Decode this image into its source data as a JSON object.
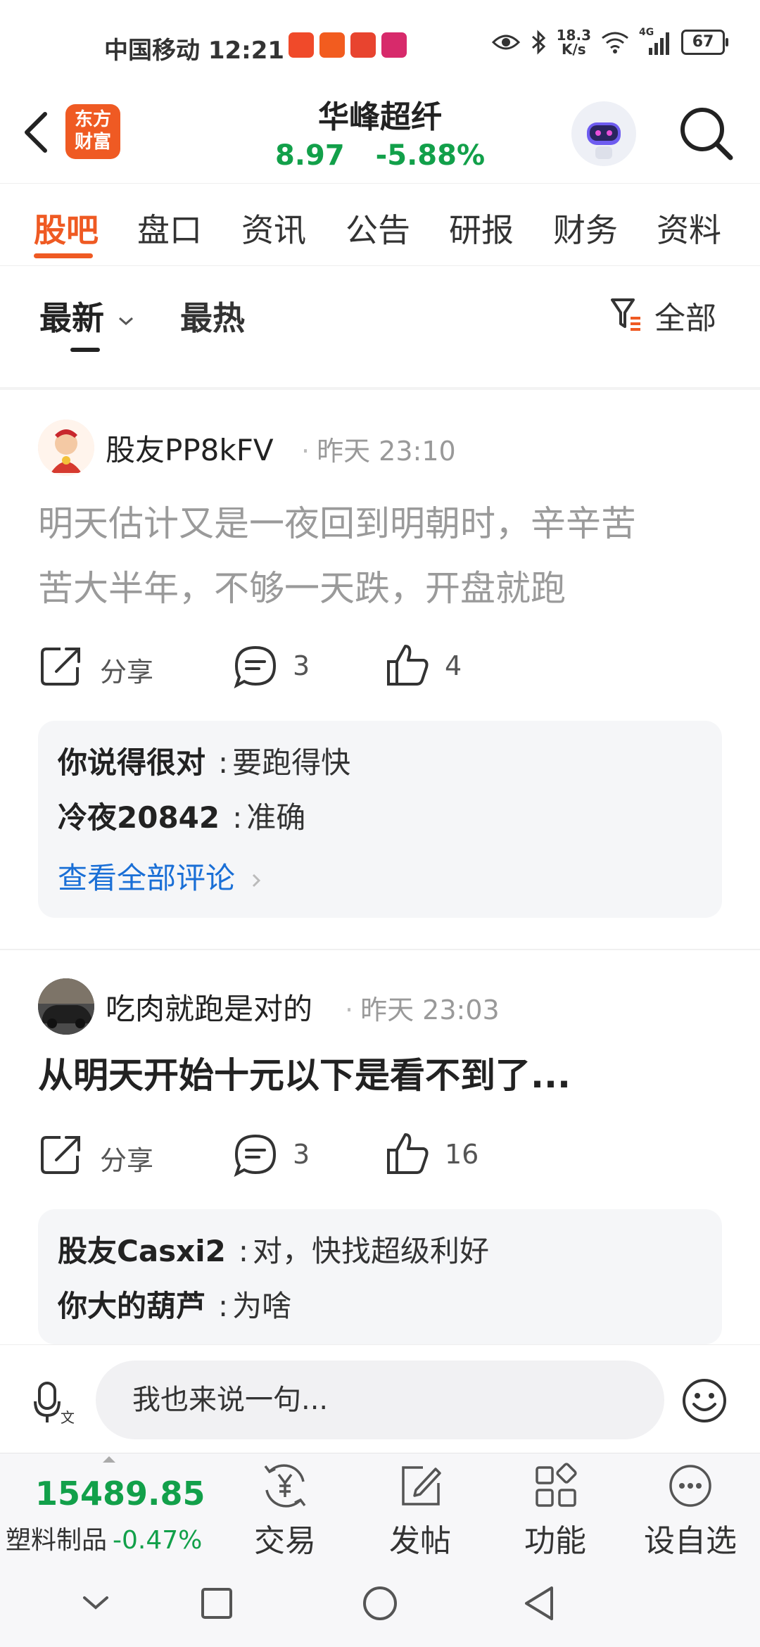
{
  "status_bar": {
    "carrier": "中国移动",
    "time": "12:21",
    "speed_value": "18.3",
    "speed_unit": "K/s",
    "network": "4G",
    "battery": "67"
  },
  "header": {
    "logo_line1": "东方",
    "logo_line2": "财富",
    "stock_name": "华峰超纤",
    "price": "8.97",
    "change_pct": "-5.88%"
  },
  "tabs": [
    {
      "label": "股吧",
      "active": true
    },
    {
      "label": "盘口"
    },
    {
      "label": "资讯"
    },
    {
      "label": "公告"
    },
    {
      "label": "研报"
    },
    {
      "label": "财务"
    },
    {
      "label": "资料"
    }
  ],
  "sort": {
    "latest": "最新",
    "hot": "最热",
    "filter": "全部"
  },
  "posts": [
    {
      "author": "股友PP8kFV",
      "time": "昨天 23:10",
      "text_line1": "明天估计又是一夜回到明朝时，辛辛苦",
      "text_line2": "苦大半年，不够一天跌，开盘就跑",
      "share": "分享",
      "comments": "3",
      "likes": "4",
      "replies": [
        {
          "name": "你说得很对",
          "sep": ":",
          "text": "要跑得快"
        },
        {
          "name": "冷夜20842",
          "sep": ":",
          "text": "准确"
        }
      ],
      "see_all": "查看全部评论"
    },
    {
      "author": "吃肉就跑是对的",
      "time": "昨天 23:03",
      "text_line1": "从明天开始十元以下是看不到了...",
      "share": "分享",
      "comments": "3",
      "likes": "16",
      "replies": [
        {
          "name": "股友Casxi2",
          "sep": ":",
          "text": "对，快找超级利好"
        },
        {
          "name": "你大的葫芦",
          "sep": ":",
          "text": "为啥"
        }
      ]
    }
  ],
  "input_bar": {
    "placeholder": "我也来说一句..."
  },
  "bottom_bar": {
    "index_value": "15489.85",
    "index_name": "塑料制品",
    "index_change": "-0.47%",
    "items": [
      {
        "label": "交易",
        "icon": "yen-exchange-icon"
      },
      {
        "label": "发帖",
        "icon": "edit-icon"
      },
      {
        "label": "功能",
        "icon": "grid-icon"
      },
      {
        "label": "设自选",
        "icon": "more-icon"
      }
    ]
  },
  "colors": {
    "brand_orange": "#ef5a23",
    "price_green": "#12a04a",
    "link_blue": "#1a6fd6"
  }
}
